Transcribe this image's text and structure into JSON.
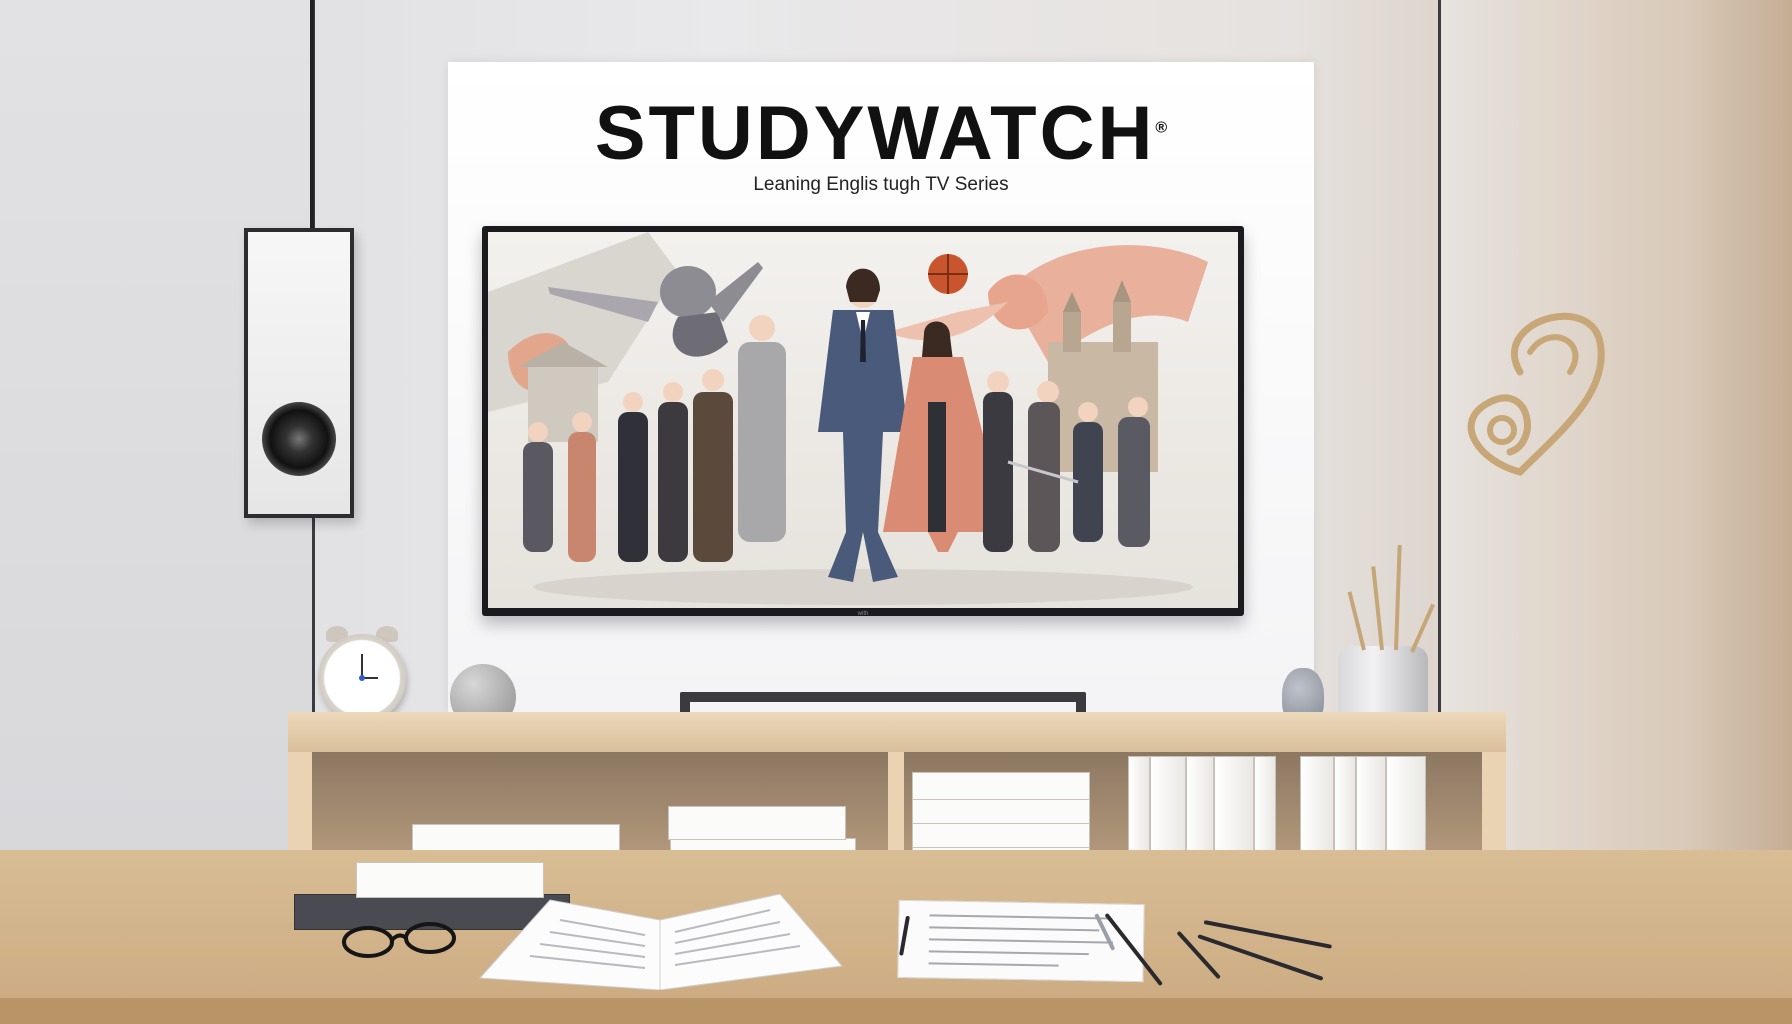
{
  "brand": {
    "name": "STUDYWATCH",
    "registered_mark": "®",
    "tagline": "Leaning Englis tugh TV Series"
  },
  "tv": {
    "brand_mark": "with"
  },
  "colors": {
    "wall": "#e4e4e6",
    "board": "#ffffff",
    "tv_frame": "#1b1b1f",
    "shelf_wood": "#e9d3b3",
    "desk_wood": "#d4b68c",
    "accent_salmon": "#e9967a",
    "suit_blue": "#4a5a7a"
  },
  "icons": {
    "speaker": "speaker-icon",
    "clock": "alarm-clock-icon",
    "ornament": "swirl-ornament-icon",
    "glasses": "eyeglasses-icon"
  }
}
